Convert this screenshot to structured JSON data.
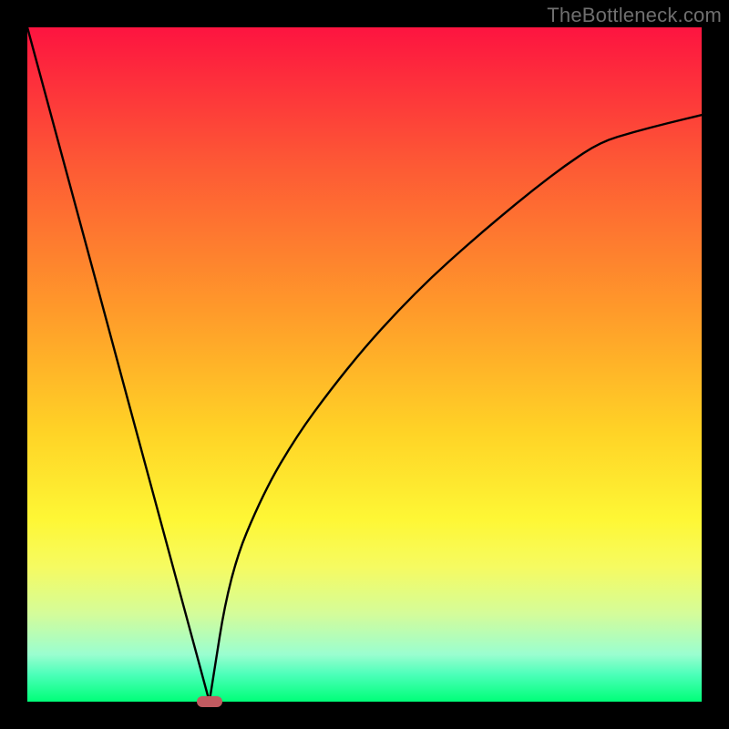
{
  "watermark": "TheBottleneck.com",
  "colors": {
    "frame_border": "#000000",
    "curve": "#000000",
    "min_marker": "#c15a60",
    "gradient_top": "#fd1440",
    "gradient_bottom": "#00ff78"
  },
  "chart_data": {
    "type": "line",
    "title": "",
    "xlabel": "",
    "ylabel": "",
    "xlim": [
      0,
      100
    ],
    "ylim": [
      0,
      100
    ],
    "y_axis_inverted": false,
    "notes": "V-shaped curve; left branch is linear, right branch is concave (square-root-like). Minimum at x≈27, y≈0. Background gradient red→green encodes higher values (worse) near top and lower values (better) near bottom.",
    "min_x": 27,
    "series": [
      {
        "name": "left-branch",
        "x": [
          0,
          5,
          10,
          15,
          20,
          25,
          27
        ],
        "y": [
          100,
          81.5,
          63,
          44.4,
          25.9,
          7.4,
          0
        ]
      },
      {
        "name": "right-branch",
        "x": [
          27,
          30,
          35,
          40,
          45,
          50,
          55,
          60,
          65,
          70,
          75,
          80,
          85,
          90,
          95,
          100
        ],
        "y": [
          0,
          19.0,
          31.0,
          39.5,
          46.3,
          52.5,
          58.0,
          63.0,
          67.5,
          71.8,
          75.9,
          79.7,
          83.0,
          84.5,
          85.8,
          87.0
        ]
      }
    ],
    "min_marker": {
      "x": 27,
      "y": 0
    }
  }
}
